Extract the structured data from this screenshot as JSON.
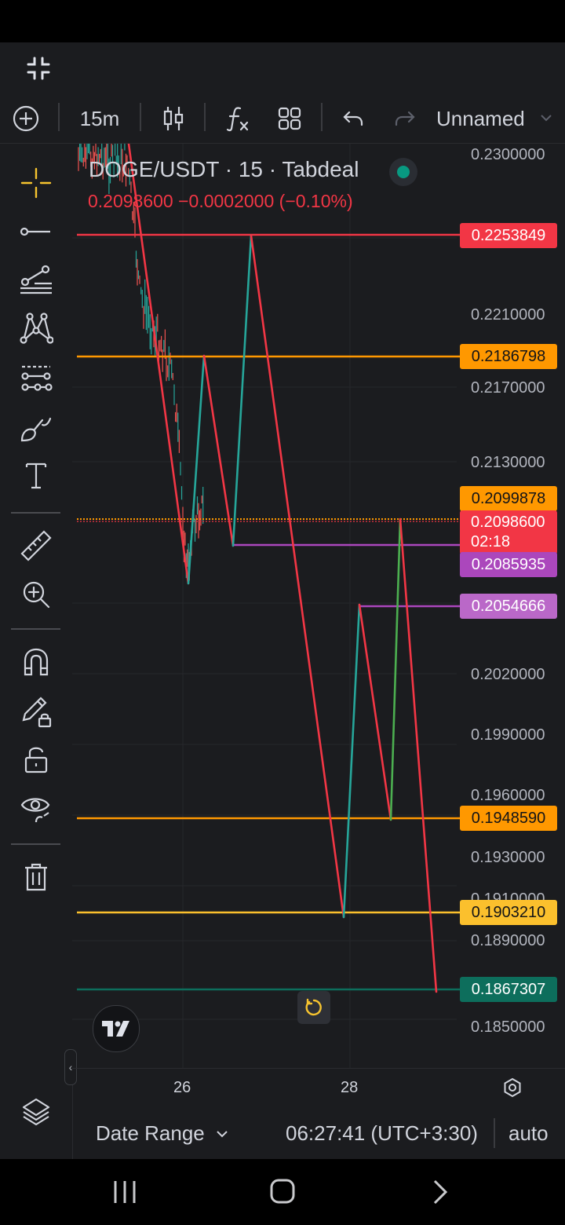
{
  "toolbar": {
    "interval": "15m",
    "layout_name": "Unnamed",
    "icons": [
      "add-symbol-icon",
      "candles-icon",
      "indicators-icon",
      "templates-icon",
      "undo-icon",
      "redo-icon"
    ]
  },
  "legend": {
    "symbol": "DOGE/USDT · 15 · Tabdeal",
    "values": "0.2098600  −0.0002000 (−0.10%)",
    "status_color": "#089981"
  },
  "y_axis": {
    "ticks": [
      "0.2300000",
      "0.2210000",
      "0.2170000",
      "0.2130000",
      "0.2020000",
      "0.1990000",
      "0.1960000",
      "0.1930000",
      "0.1910000",
      "0.1890000",
      "0.1850000"
    ]
  },
  "price_tags": {
    "t1": "0.2253849",
    "t2": "0.2186798",
    "t3": "0.2099878",
    "current_price": "0.2098600",
    "countdown": "02:18",
    "t4": "0.2085935",
    "t5": "0.2054666",
    "t6": "0.1948590",
    "t7": "0.1903210",
    "t8": "0.1867307"
  },
  "x_axis": {
    "ticks": [
      "26",
      "28"
    ]
  },
  "bottom": {
    "date_range": "Date Range",
    "clock": "06:27:41 (UTC+3:30)",
    "scale_mode": "auto"
  },
  "colors": {
    "red": "#f23645",
    "orange": "#ff9800",
    "yellow": "#fbc02d",
    "purple": "#ab47bc",
    "green": "#089981",
    "teal": "#26a69a"
  },
  "chart_data": {
    "type": "line",
    "title": "DOGE/USDT · 15 · Tabdeal",
    "horizontal_levels": [
      {
        "value": 0.2253849,
        "color": "#f23645"
      },
      {
        "value": 0.2186798,
        "color": "#ff9800"
      },
      {
        "value": 0.2099878,
        "color": "#ff9800"
      },
      {
        "value": 0.2085935,
        "color": "#ab47bc"
      },
      {
        "value": 0.2054666,
        "color": "#ab47bc"
      },
      {
        "value": 0.194859,
        "color": "#ff9800"
      },
      {
        "value": 0.190321,
        "color": "#fbc02d"
      },
      {
        "value": 0.1867307,
        "color": "#089981"
      }
    ],
    "last_price": 0.20986,
    "ylim": [
      0.1838,
      0.2305
    ]
  }
}
